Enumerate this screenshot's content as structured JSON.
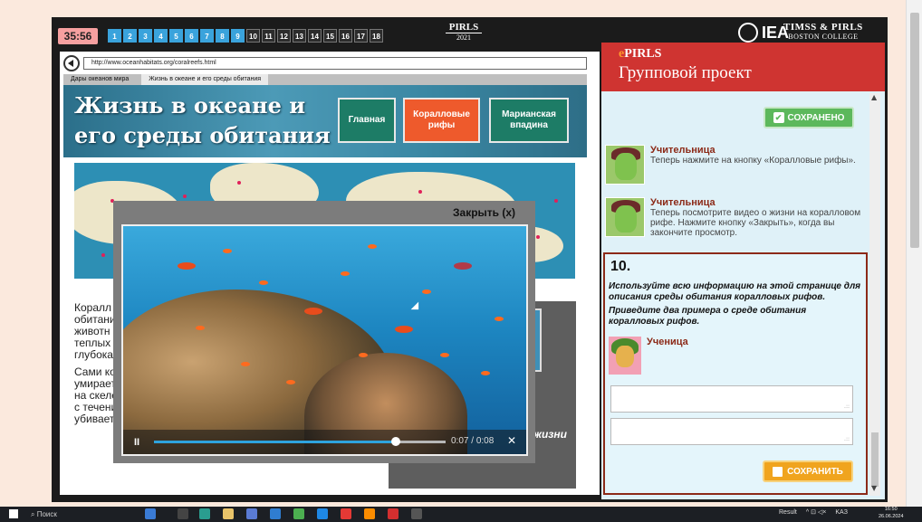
{
  "topbar": {
    "timer": "35:56",
    "questions": [
      {
        "n": "1",
        "done": true
      },
      {
        "n": "2",
        "done": true
      },
      {
        "n": "3",
        "done": true
      },
      {
        "n": "4",
        "done": true
      },
      {
        "n": "5",
        "done": true
      },
      {
        "n": "6",
        "done": true
      },
      {
        "n": "7",
        "done": true
      },
      {
        "n": "8",
        "done": true
      },
      {
        "n": "9",
        "done": true
      },
      {
        "n": "10",
        "done": false
      },
      {
        "n": "11",
        "done": false
      },
      {
        "n": "12",
        "done": false
      },
      {
        "n": "13",
        "done": false
      },
      {
        "n": "14",
        "done": false
      },
      {
        "n": "15",
        "done": false
      },
      {
        "n": "16",
        "done": false
      },
      {
        "n": "17",
        "done": false
      },
      {
        "n": "18",
        "done": false
      }
    ],
    "pirls": "PIRLS",
    "year": "2021",
    "iea": "IEA",
    "timss_pirls": "TIMSS & PIRLS",
    "boston": "BOSTON COLLEGE"
  },
  "browser": {
    "url": "http://www.oceanhabitats.org/coralreefs.html",
    "breadcrumb": [
      "Дары океанов мира",
      "Жизнь в океане и его среды обитания"
    ],
    "hero_title_line1": "Жизнь в океане и",
    "hero_title_line2": "его среды обитания",
    "nav": {
      "main": "Главная",
      "coral": "Коралловые рифы",
      "mariana": "Марианская впадина"
    },
    "body_p1": [
      "Коралл",
      "обитани",
      "животн",
      "теплых",
      "глубока"
    ],
    "body_p2": [
      "Сами ко",
      "умирает",
      "на скеле",
      "с течени",
      "убивает"
    ],
    "side_label": "жизни"
  },
  "video": {
    "close_label": "Закрыть (x)",
    "play_symbol": "II",
    "time_current": "0:07",
    "time_total": "0:08",
    "progress": 0.83
  },
  "panel": {
    "epirls_e": "e",
    "epirls_rest": "PIRLS",
    "title": "Групповой проект",
    "saved_label": "СОХРАНЕНО",
    "messages": [
      {
        "who": "Учительница",
        "text": "Теперь нажмите на кнопку «Коралловые рифы»."
      },
      {
        "who": "Учительница",
        "text": "Теперь посмотрите видео о жизни на коралловом рифе. Нажмите кнопку «Закрыть», когда вы закончите просмотр."
      }
    ],
    "question_number": "10.",
    "question_p1": "Используйте всю информацию на этой странице для описания среды обитания коралловых рифов.",
    "question_p2": "Приведите два примера о среде обитания коралловых рифов.",
    "student": "Ученица",
    "save_label": "СОХРАНИТЬ"
  },
  "taskbar": {
    "search": "Поиск",
    "result_label": "Result",
    "lang": "KAЗ",
    "time": "16:50",
    "date": "26.06.2024"
  }
}
